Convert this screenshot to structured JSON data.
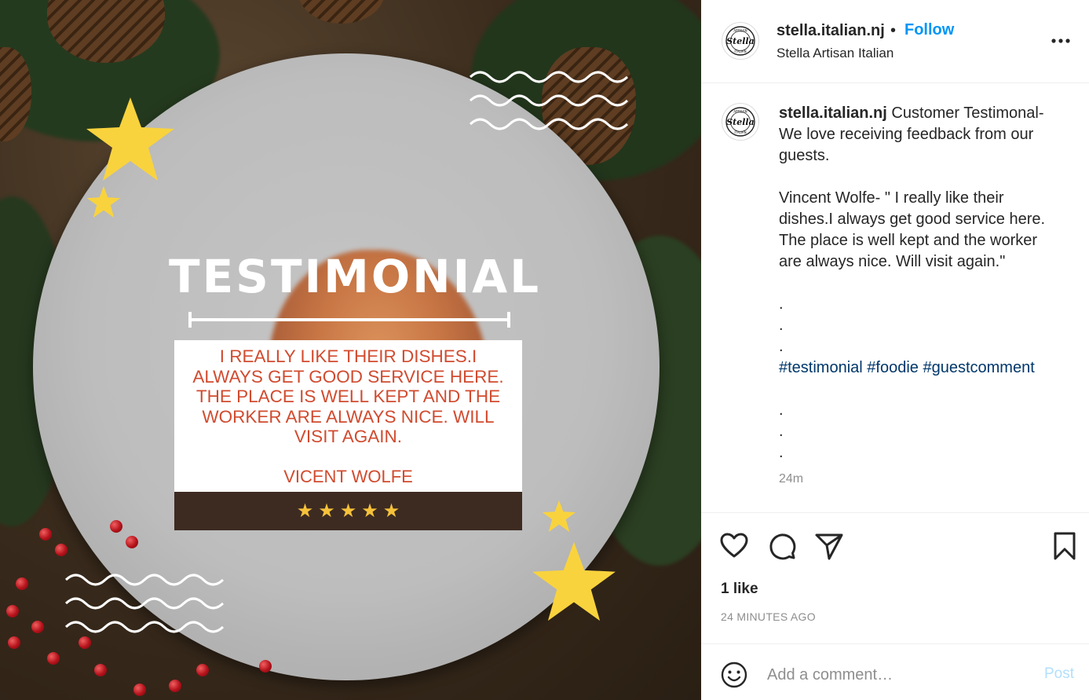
{
  "post_image": {
    "title": "TESTIMONIAL",
    "quote": "I REALLY LIKE THEIR DISHES.I ALWAYS GET GOOD SERVICE HERE. THE PLACE IS WELL KEPT AND THE WORKER ARE ALWAYS NICE. WILL VISIT AGAIN.",
    "author": "VICENT WOLFE",
    "rating": 5,
    "rating_star_glyph": "★",
    "accent_color": "#d14b2f",
    "rating_bar_color": "#3d2b22",
    "star_color": "#f6c23a"
  },
  "header": {
    "username": "stella.italian.nj",
    "separator": "•",
    "follow_label": "Follow",
    "subtitle": "Stella Artisan Italian",
    "avatar_logo_text": "Stella",
    "avatar_ring_top": "ARTISAN",
    "avatar_ring_bottom": "ITALIAN",
    "more_icon": "more-horizontal-icon"
  },
  "caption": {
    "username": "stella.italian.nj",
    "line1": "Customer Testimonal-",
    "line2": "We love receiving feedback from our",
    "line3": "guests.",
    "line4": "Vincent Wolfe- \" I really like their",
    "line5": "dishes.I always get good service here.",
    "line6": "The place is well kept and the worker",
    "line7": "are always nice. Will visit again.\"",
    "dots_a": [
      ".",
      ".",
      "."
    ],
    "hashtags": [
      "#testimonial",
      "#foodie",
      "#guestcomment"
    ],
    "dots_b": [
      ".",
      ".",
      "."
    ],
    "age": "24m"
  },
  "actions": {
    "icons": [
      "heart-icon",
      "comment-icon",
      "share-icon",
      "bookmark-icon"
    ],
    "likes": "1 like",
    "timestamp": "24 MINUTES AGO"
  },
  "comment": {
    "placeholder": "Add a comment…",
    "post_label": "Post",
    "emoji_icon": "emoji-icon"
  },
  "colors": {
    "link_blue": "#0095f6",
    "hashtag_blue": "#00376b",
    "muted_gray": "#8e8e8e",
    "post_disabled": "#b2dffc"
  }
}
